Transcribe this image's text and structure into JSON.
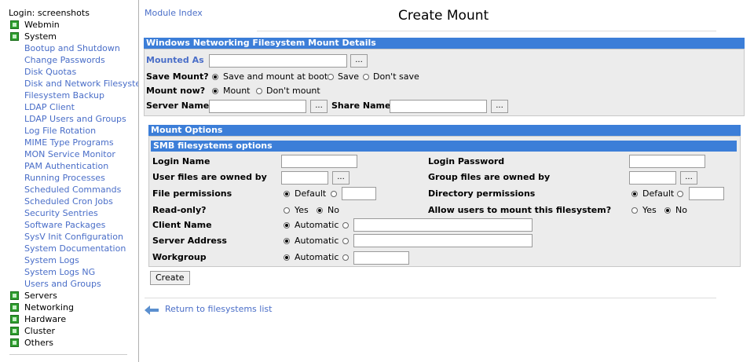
{
  "sidebar": {
    "login": "Login: screenshots",
    "categories": [
      {
        "label": "Webmin"
      },
      {
        "label": "System"
      }
    ],
    "system_items": [
      "Bootup and Shutdown",
      "Change Passwords",
      "Disk Quotas",
      "Disk and Network Filesystems",
      "Filesystem Backup",
      "LDAP Client",
      "LDAP Users and Groups",
      "Log File Rotation",
      "MIME Type Programs",
      "MON Service Monitor",
      "PAM Authentication",
      "Running Processes",
      "Scheduled Commands",
      "Scheduled Cron Jobs",
      "Security Sentries",
      "Software Packages",
      "SysV Init Configuration",
      "System Documentation",
      "System Logs",
      "System Logs NG",
      "Users and Groups"
    ],
    "more_categories": [
      "Servers",
      "Networking",
      "Hardware",
      "Cluster",
      "Others"
    ]
  },
  "header": {
    "module_index": "Module Index",
    "title": "Create Mount"
  },
  "details": {
    "header": "Windows Networking Filesystem Mount Details",
    "mounted_as_label": "Mounted As",
    "mounted_as_value": "",
    "browse": "...",
    "save_mount_label": "Save Mount?",
    "save_opts": [
      "Save and mount at boot",
      "Save",
      "Don't save"
    ],
    "mount_now_label": "Mount now?",
    "mount_now_opts": [
      "Mount",
      "Don't mount"
    ],
    "server_name_label": "Server Name",
    "server_name_value": "",
    "share_name_label": "Share Name",
    "share_name_value": ""
  },
  "options": {
    "header": "Mount Options",
    "smb_header": "SMB filesystems options",
    "login_name": "Login Name",
    "login_password": "Login Password",
    "user_files_owned": "User files are owned by",
    "group_files_owned": "Group files are owned by",
    "file_permissions": "File permissions",
    "directory_permissions": "Directory permissions",
    "default": "Default",
    "read_only": "Read-only?",
    "allow_users_mount": "Allow users to mount this filesystem?",
    "yes": "Yes",
    "no": "No",
    "client_name": "Client Name",
    "server_address": "Server Address",
    "workgroup": "Workgroup",
    "automatic": "Automatic"
  },
  "actions": {
    "create": "Create",
    "return": "Return to filesystems list"
  }
}
